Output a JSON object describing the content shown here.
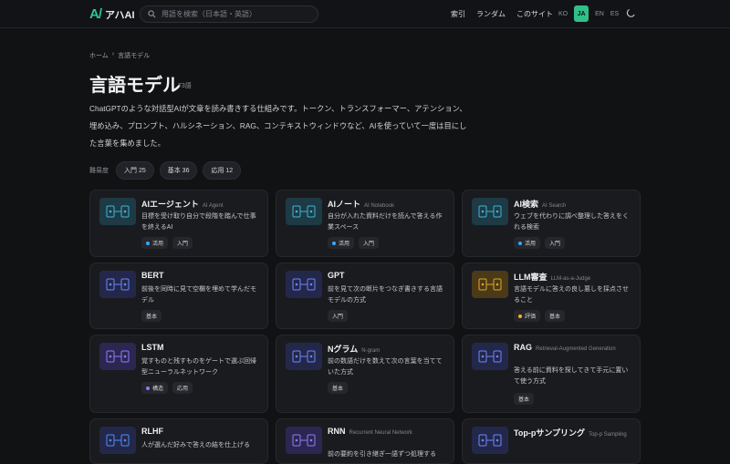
{
  "header": {
    "logo_mark": "A/",
    "logo_text": "アハAI",
    "search_placeholder": "用語を検索（日本語・英語）",
    "nav": [
      "索引",
      "ランダム",
      "このサイト"
    ],
    "langs": [
      "KO",
      "JA",
      "EN",
      "ES"
    ],
    "active_lang": "JA"
  },
  "breadcrumb": [
    "ホーム",
    "›",
    "言語モデル"
  ],
  "page": {
    "title": "言語モデル",
    "count": "73語",
    "description": "ChatGPTのような対話型AIが文章を読み書きする仕組みです。トークン、トランスフォーマー、アテンション、埋め込み、プロンプト、ハルシネーション、RAG、コンテキストウィンドウなど、AIを使っていて一度は目にした言葉を集めました。"
  },
  "filters": {
    "label": "難易度",
    "chips": [
      "入門 25",
      "基本 36",
      "応用 12"
    ]
  },
  "colors": {
    "accent": "#2fbf88",
    "bg": "#111214",
    "card": "#1a1b1f"
  },
  "cards": [
    {
      "title": "AIエージェント",
      "sub": "AI Agent",
      "desc": "目標を受け取り自分で段階を踏んで仕事を終えるAI",
      "tags": [
        "活用",
        "入門"
      ],
      "dot": "#38a7ff",
      "icon": "agent-icon"
    },
    {
      "title": "AIノート",
      "sub": "AI Notebook",
      "desc": "自分が入れた資料だけを読んで答える作業スペース",
      "tags": [
        "活用",
        "入門"
      ],
      "dot": "#38a7ff",
      "icon": "notebook-icon"
    },
    {
      "title": "AI検索",
      "sub": "AI Search",
      "desc": "ウェブを代わりに調べ整理した答えをくれる検索",
      "tags": [
        "活用",
        "入門"
      ],
      "dot": "#38a7ff",
      "icon": "search-icon"
    },
    {
      "title": "BERT",
      "sub": "",
      "desc": "前後を同時に見て空欄を埋めて学んだモデル",
      "tags": [
        "基本"
      ],
      "dot": "",
      "icon": "bert-icon"
    },
    {
      "title": "GPT",
      "sub": "",
      "desc": "前を見て次の断片をつなぎ書きする言語モデルの方式",
      "tags": [
        "入門"
      ],
      "dot": "",
      "icon": "gpt-icon"
    },
    {
      "title": "LLM審査",
      "sub": "LLM-as-a-Judge",
      "desc": "言語モデルに答えの良し悪しを採点させること",
      "tags": [
        "評価",
        "基本"
      ],
      "dot": "#f0b429",
      "icon": "judge-icon"
    },
    {
      "title": "LSTM",
      "sub": "",
      "desc": "覚すものと残すものをゲートで選ぶ回帰型ニューラルネットワーク",
      "tags": [
        "構造",
        "応用"
      ],
      "dot": "#8c7cff",
      "icon": "lstm-icon"
    },
    {
      "title": "Nグラム",
      "sub": "N-gram",
      "desc": "前の数語だけを数えて次の言葉を当てていた方式",
      "tags": [
        "基本"
      ],
      "dot": "",
      "icon": "ngram-icon"
    },
    {
      "title": "RAG",
      "sub": "Retrieval-Augmented Generation",
      "desc": "答える前に資料を探してきて手元に置いて使う方式",
      "tags": [
        "基本"
      ],
      "dot": "",
      "icon": "rag-icon"
    },
    {
      "title": "RLHF",
      "sub": "",
      "desc": "人が選んだ好みで答えの結を仕上げる",
      "tags": [],
      "dot": "",
      "icon": "rlhf-icon"
    },
    {
      "title": "RNN",
      "sub": "Recurrent Neural Network",
      "desc": "前の要約を引き継ぎ一語ずつ処理する",
      "tags": [],
      "dot": "",
      "icon": "rnn-icon"
    },
    {
      "title": "Top-pサンプリング",
      "sub": "Top-p Sampling",
      "desc": "",
      "tags": [],
      "dot": "",
      "icon": "top-p-icon"
    }
  ]
}
